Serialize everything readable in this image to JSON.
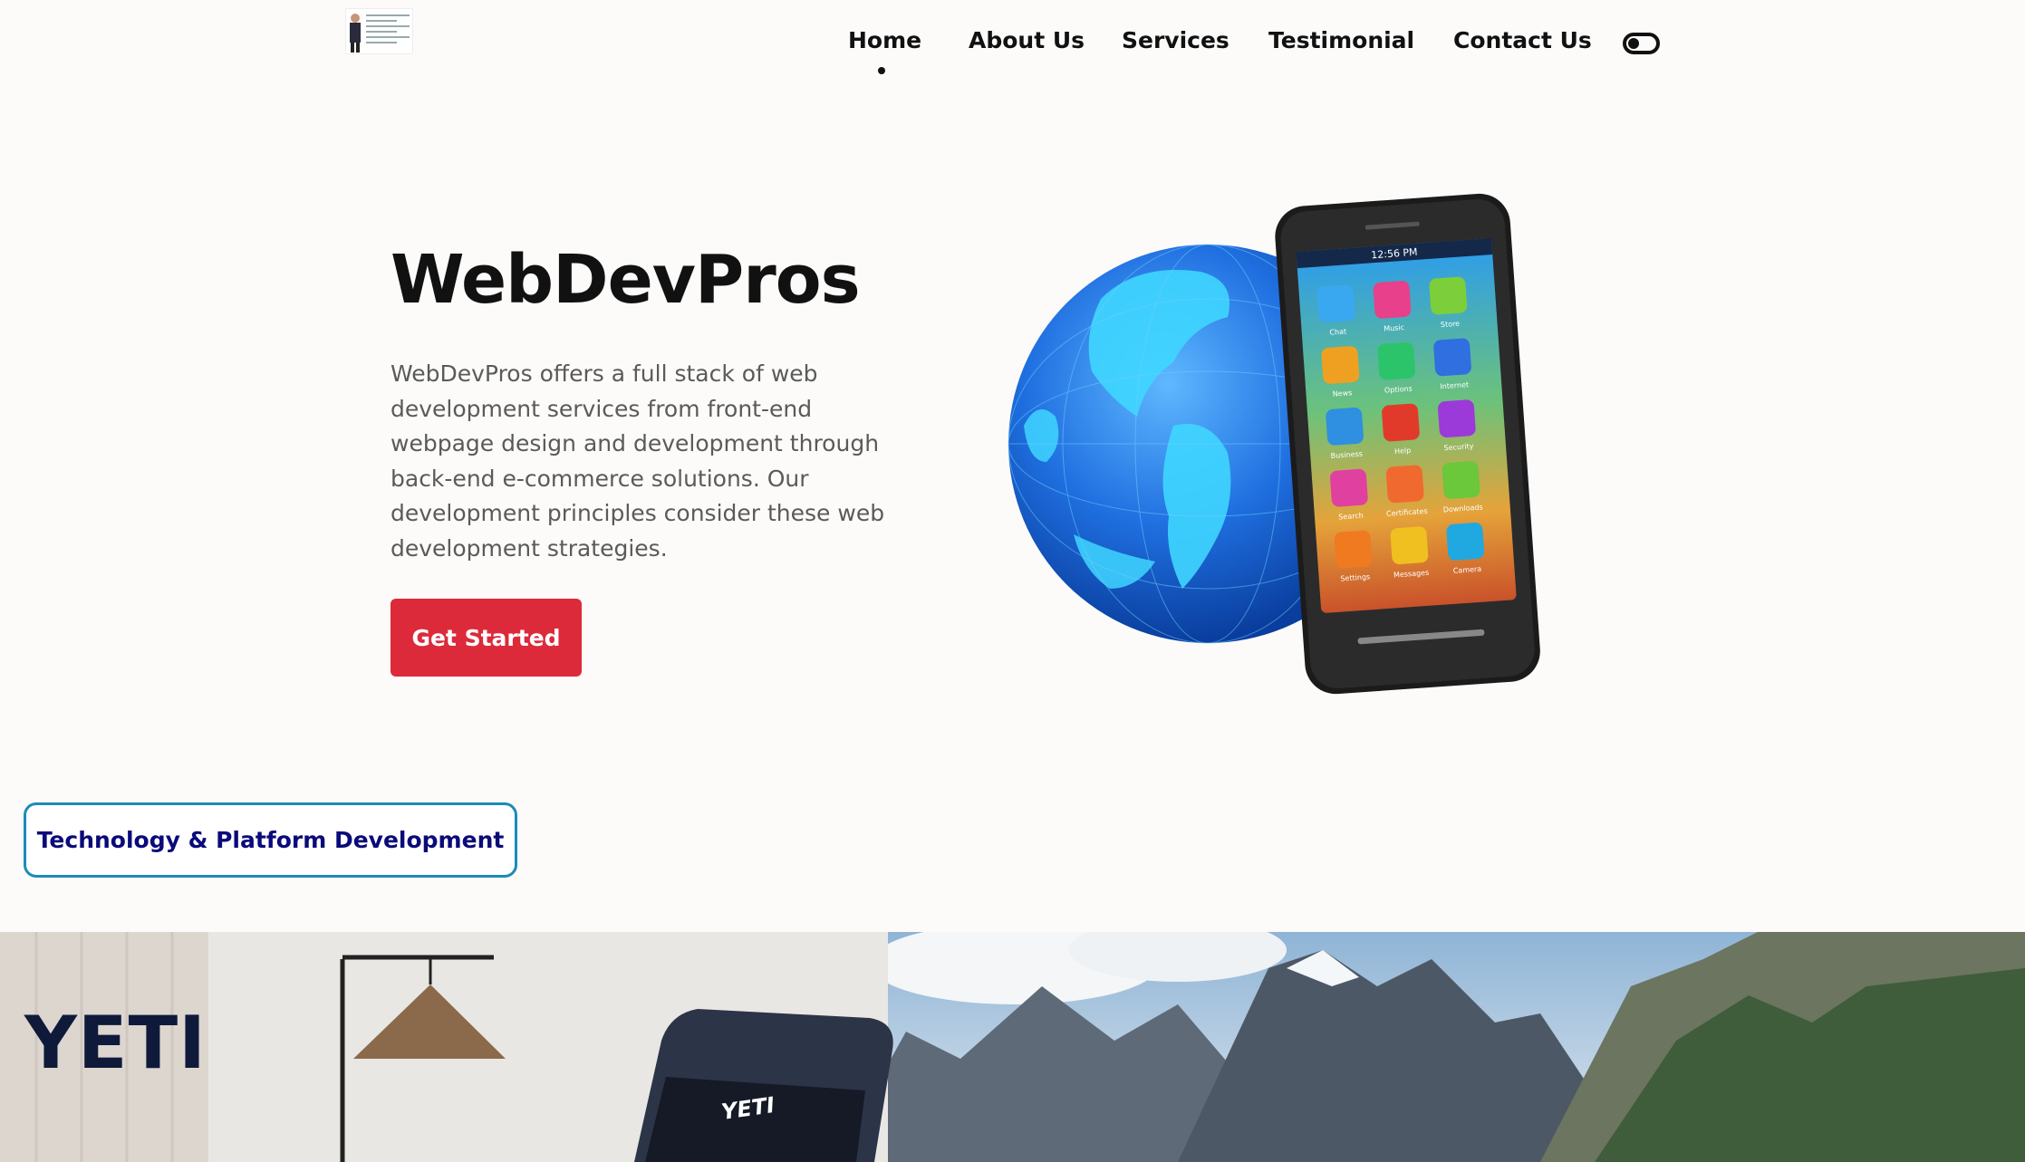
{
  "nav": {
    "items": [
      {
        "label": "Home",
        "active": true
      },
      {
        "label": "About Us"
      },
      {
        "label": "Services"
      },
      {
        "label": "Testimonial"
      },
      {
        "label": "Contact Us"
      }
    ]
  },
  "hero": {
    "title": "WebDevPros",
    "description": "WebDevPros offers a full stack of web development services from front-end webpage design and development through back-end e-commerce solutions. Our development principles consider these web development strategies.",
    "cta_label": "Get Started",
    "phone_time": "12:56 PM",
    "apps": [
      "Chat",
      "Music",
      "Store",
      "News",
      "Options",
      "Internet",
      "Business",
      "Help",
      "Security",
      "Search",
      "Certificates",
      "Downloads",
      "Settings",
      "Messages",
      "Camera"
    ]
  },
  "tech": {
    "label": "Technology & Platform Development"
  },
  "banner": {
    "title": "YETI",
    "device_label": "YETI"
  },
  "colors": {
    "cta": "#dc2a3a",
    "badge_border": "#1b8bb8",
    "badge_text": "#0a0a7a",
    "page_bg": "#fcfbfa"
  }
}
